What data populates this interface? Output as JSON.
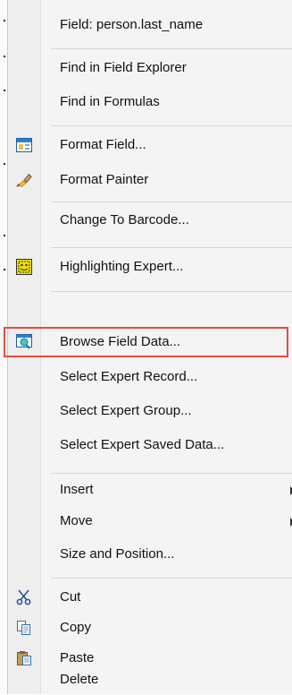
{
  "menu": {
    "items": [
      {
        "label": "Field: person.last_name",
        "icon": null
      },
      {
        "label": "Find in Field Explorer",
        "icon": null
      },
      {
        "label": "Find in Formulas",
        "icon": null
      },
      {
        "label": "Format Field...",
        "icon": "format-field-icon"
      },
      {
        "label": "Format Painter",
        "icon": "format-painter-icon"
      },
      {
        "label": "Change To Barcode...",
        "icon": null
      },
      {
        "label": "Highlighting Expert...",
        "icon": "highlighting-expert-icon"
      },
      {
        "label": "Browse Field Data...",
        "icon": "browse-field-data-icon"
      },
      {
        "label": "Select Expert Record...",
        "icon": null
      },
      {
        "label": "Select Expert Group...",
        "icon": null
      },
      {
        "label": "Select Expert Saved Data...",
        "icon": null
      },
      {
        "label": "Insert",
        "icon": null,
        "submenu": true
      },
      {
        "label": "Move",
        "icon": null,
        "submenu": true
      },
      {
        "label": "Size and Position...",
        "icon": null
      },
      {
        "label": "Cut",
        "icon": "cut-icon"
      },
      {
        "label": "Copy",
        "icon": "copy-icon"
      },
      {
        "label": "Paste",
        "icon": "paste-icon"
      },
      {
        "label": "Delete",
        "icon": null
      }
    ]
  },
  "colors": {
    "highlight_border": "#e74c3c",
    "menu_background": "#f4f4f4",
    "gutter_background": "#eeeeee"
  }
}
